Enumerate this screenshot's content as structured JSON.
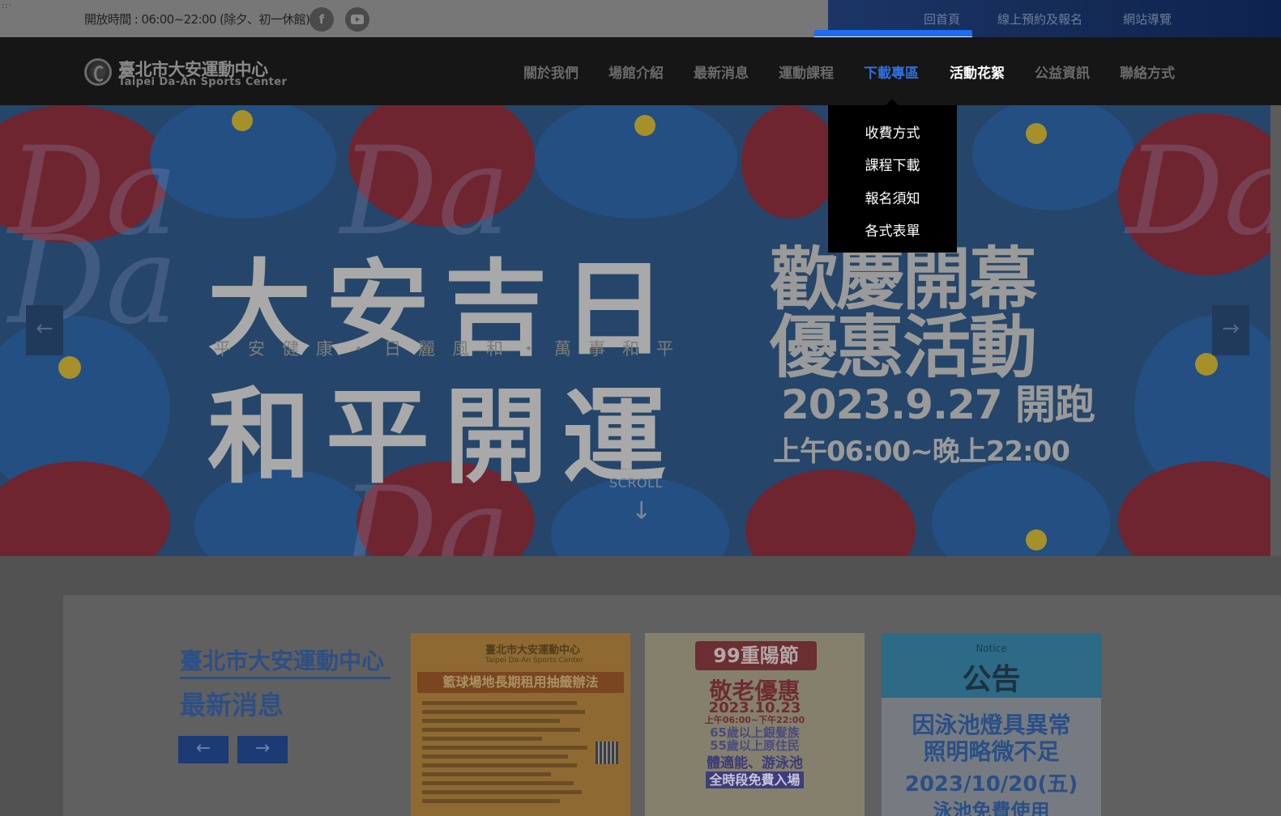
{
  "topbar": {
    "corner_mark": "::·",
    "hours": "開放時間 : 06:00~22:00 (除夕、初一休館)",
    "facebook_glyph": "f",
    "links": [
      "回首頁",
      "線上預約及報名",
      "網站導覽"
    ]
  },
  "logo": {
    "name_cn": "臺北市大安運動中心",
    "name_en": "Taipei Da-An Sports Center"
  },
  "nav": {
    "items": [
      "關於我們",
      "場館介紹",
      "最新消息",
      "運動課程",
      "下載專區",
      "活動花絮",
      "公益資訊",
      "聯絡方式"
    ],
    "active": "下載專區",
    "dropdown": [
      "收費方式",
      "課程下載",
      "報名須知",
      "各式表單"
    ]
  },
  "hero": {
    "line1": "大安吉日",
    "subtitle": "平安健康・日麗風和・萬事和平",
    "line2": "和平開運",
    "right_line1": "歡慶開幕",
    "right_line2": "優惠活動",
    "date_line": "2023.9.27 開跑",
    "time_line": "上午06:00~晚上22:00",
    "script_text": "Da",
    "scroll_label": "SCROLL",
    "scroll_arrow": "↓",
    "prev_arrow": "←",
    "next_arrow": "→"
  },
  "news": {
    "title_line1": "臺北市大安運動中心",
    "title_line2": "最新消息",
    "prev_arrow": "←",
    "next_arrow": "→",
    "cards": [
      {
        "header_cn": "臺北市大安運動中心",
        "header_en": "Taipei Da-An Sports Center",
        "title": "籃球場地長期租用抽籤辦法"
      },
      {
        "header": "99重陽節",
        "line1": "敬老優惠",
        "line2": "2023.10.23",
        "line3": "上午06:00~下午22:00",
        "line4": "65歲以上銀髮族",
        "line5": "55歲以上原住民",
        "line6": "體適能、游泳池",
        "line7": "全時段免費入場"
      },
      {
        "notice": "Notice",
        "title": "公告",
        "line1": "因泳池燈具異常",
        "line2": "照明略微不足",
        "line3": "2023/10/20(五)",
        "line4": "泳池免費使用"
      }
    ]
  },
  "colors": {
    "accent_blue": "#1e6cf0",
    "nav_active": "#2f6fe0",
    "news_title": "#2c4f86",
    "overlay_bg": "#161616"
  }
}
